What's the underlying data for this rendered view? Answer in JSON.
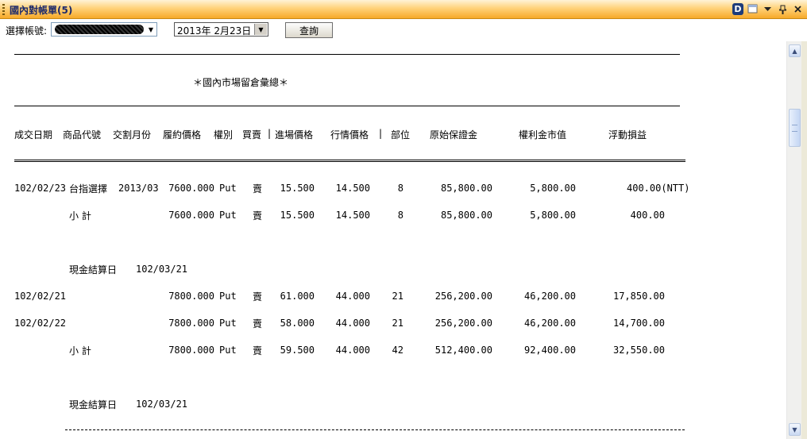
{
  "window": {
    "title": "國內對帳單(5)",
    "icons": [
      "d-icon",
      "window-icon",
      "dropdown-icon",
      "pin-icon",
      "close-icon"
    ]
  },
  "toolbar": {
    "account_label": "選擇帳號:",
    "account_value": "",
    "date_value": "2013年  2月23日",
    "query_label": "查詢"
  },
  "report": {
    "heading": "＊國內市場留倉彙總＊",
    "columns": [
      "成交日期",
      "商品代號",
      "交割月份",
      "履約價格",
      "權別",
      "買賣",
      "|",
      "進場價格",
      "行情價格",
      "|",
      "部位",
      "原始保證金",
      "權利金市值",
      "浮動損益"
    ],
    "rows": [
      {
        "date": "102/02/23",
        "product": "台指選擇",
        "month": "2013/03",
        "strike": "7600.000",
        "right": "Put",
        "side": "賣",
        "entry": "15.500",
        "market": "14.500",
        "pos": "8",
        "margin": "85,800.00",
        "premium": "5,800.00",
        "pnl": "400.00(NTT)"
      },
      {
        "date": "",
        "product": "小  計",
        "month": "",
        "strike": "7600.000",
        "right": "Put",
        "side": "賣",
        "entry": "15.500",
        "market": "14.500",
        "pos": "8",
        "margin": "85,800.00",
        "premium": "5,800.00",
        "pnl": "400.00"
      },
      {
        "date": "",
        "product": "現金結算日",
        "month": "102/03/21",
        "strike": "",
        "right": "",
        "side": "",
        "entry": "",
        "market": "",
        "pos": "",
        "margin": "",
        "premium": "",
        "pnl": ""
      },
      {
        "date": "102/02/21",
        "product": "",
        "month": "",
        "strike": "7800.000",
        "right": "Put",
        "side": "賣",
        "entry": "61.000",
        "market": "44.000",
        "pos": "21",
        "margin": "256,200.00",
        "premium": "46,200.00",
        "pnl": "17,850.00"
      },
      {
        "date": "102/02/22",
        "product": "",
        "month": "",
        "strike": "7800.000",
        "right": "Put",
        "side": "賣",
        "entry": "58.000",
        "market": "44.000",
        "pos": "21",
        "margin": "256,200.00",
        "premium": "46,200.00",
        "pnl": "14,700.00"
      },
      {
        "date": "",
        "product": "小  計",
        "month": "",
        "strike": "7800.000",
        "right": "Put",
        "side": "賣",
        "entry": "59.500",
        "market": "44.000",
        "pos": "42",
        "margin": "512,400.00",
        "premium": "92,400.00",
        "pnl": "32,550.00"
      },
      {
        "date": "",
        "product": "現金結算日",
        "month": "102/03/21",
        "strike": "",
        "right": "",
        "side": "",
        "entry": "",
        "market": "",
        "pos": "",
        "margin": "",
        "premium": "",
        "pnl": ""
      }
    ]
  }
}
